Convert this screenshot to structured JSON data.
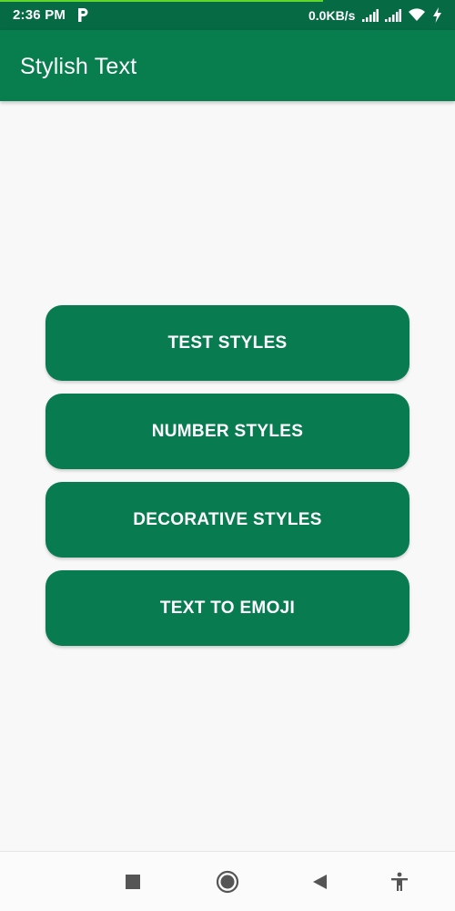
{
  "status_bar": {
    "time": "2:36 PM",
    "network_speed": "0.0KB/s",
    "icons": [
      "p-icon",
      "signal-icon",
      "signal-icon",
      "wifi-icon",
      "charging-bolt-icon"
    ],
    "background_color": "#066a44",
    "progress_color": "#5fd82b"
  },
  "app_bar": {
    "title": "Stylish Text",
    "background_color": "#087e4e"
  },
  "menu": {
    "button_color": "#087c50",
    "buttons": [
      {
        "label": "TEST STYLES"
      },
      {
        "label": "NUMBER STYLES"
      },
      {
        "label": "DECORATIVE STYLES"
      },
      {
        "label": "TEXT TO EMOJI"
      }
    ]
  },
  "nav_bar": {
    "icons": [
      "recents-square-icon",
      "home-circle-icon",
      "back-triangle-icon",
      "accessibility-icon"
    ]
  }
}
